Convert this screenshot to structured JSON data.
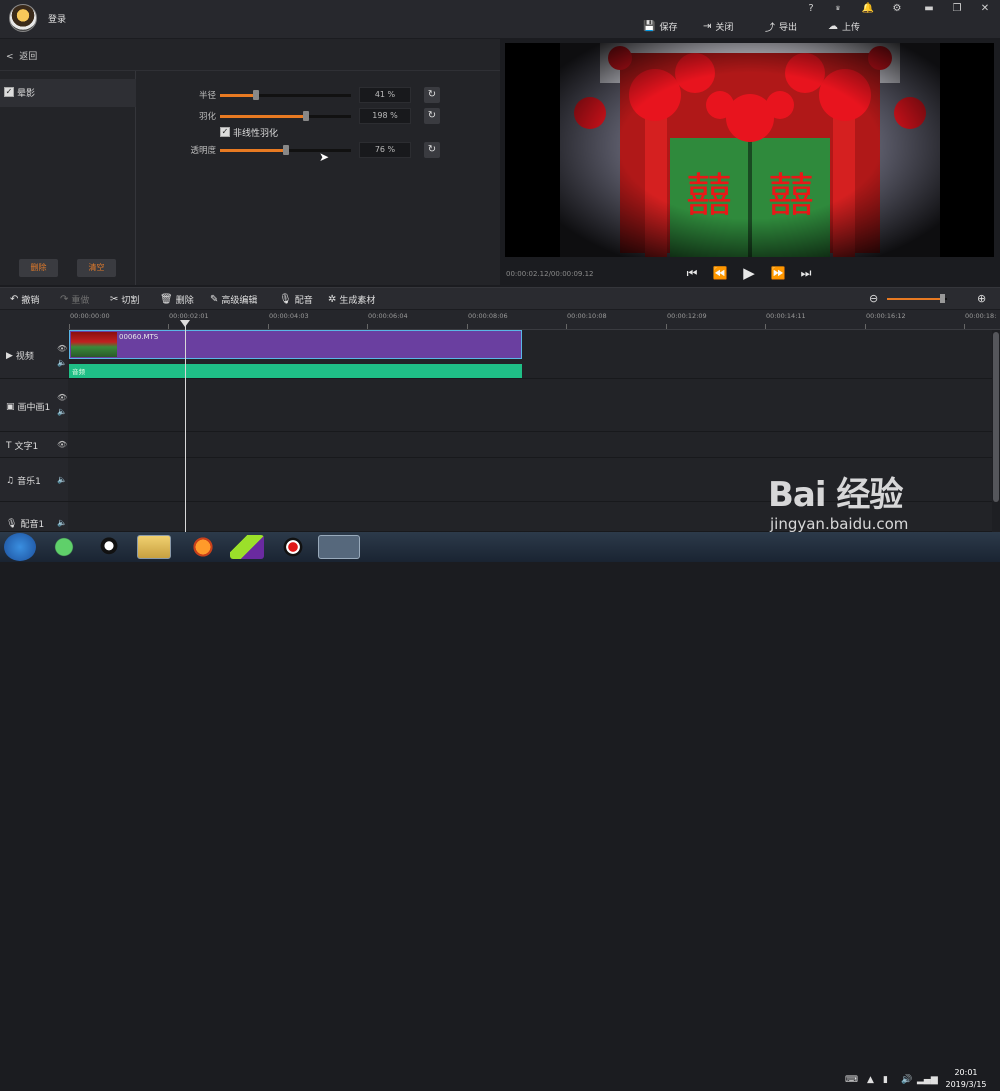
{
  "title_bar": {
    "login_label": "登录",
    "window_buttons": [
      "?",
      "VIP",
      "bell-icon",
      "gear-icon",
      "minimize",
      "restore",
      "close"
    ],
    "actions": [
      {
        "icon": "save-icon",
        "label": "保存"
      },
      {
        "icon": "exit-icon",
        "label": "关闭"
      },
      {
        "icon": "export-icon",
        "label": "导出"
      },
      {
        "icon": "upload-icon",
        "label": "上传"
      }
    ]
  },
  "effects_panel": {
    "back_label": "返回",
    "effect_name": "晕影",
    "effect_checked": true,
    "delete_label": "删除",
    "clear_label": "清空",
    "params": [
      {
        "label": "半径",
        "value": 41,
        "display": "41 %"
      },
      {
        "label": "羽化",
        "value": 198,
        "max": 300,
        "display": "198 %"
      },
      {
        "label": "透明度",
        "value": 76,
        "display": "76 %"
      }
    ],
    "nonlinear_label": "非线性羽化",
    "nonlinear_checked": true
  },
  "preview": {
    "timecode": "00:00:02.12/00:00:09.12",
    "sign_text": "囍",
    "controls": [
      "skip-start-icon",
      "prev-frame-icon",
      "play-icon",
      "next-frame-icon",
      "skip-end-icon"
    ]
  },
  "toolbar": {
    "tools": [
      {
        "icon": "undo-icon",
        "label": "撤销",
        "enabled": true
      },
      {
        "icon": "redo-icon",
        "label": "重做",
        "enabled": false
      },
      {
        "icon": "cut-icon",
        "label": "切割",
        "enabled": true
      },
      {
        "icon": "trash-icon",
        "label": "删除",
        "enabled": true
      },
      {
        "icon": "edit-icon",
        "label": "高级编辑",
        "enabled": true
      },
      {
        "icon": "mic-icon",
        "label": "配音",
        "enabled": true
      },
      {
        "icon": "film-icon",
        "label": "生成素材",
        "enabled": true
      }
    ],
    "zoom_level": 0.92
  },
  "timeline": {
    "ruler_ticks": [
      "00:00:00:00",
      "00:00:02:01",
      "00:00:04:03",
      "00:00:06:04",
      "00:00:08:06",
      "00:00:10:08",
      "00:00:12:09",
      "00:00:14:11",
      "00:00:16:12",
      "00:00:18:"
    ],
    "tracks": [
      {
        "icon": "▶",
        "label": "视频"
      },
      {
        "icon": "▣",
        "label": "画中画1"
      },
      {
        "icon": "T",
        "label": "文字1"
      },
      {
        "icon": "♫",
        "label": "音乐1"
      },
      {
        "icon": "🎙",
        "label": "配音1"
      }
    ],
    "clip_name": "00060.MTS",
    "audio_clip_label": "音频"
  },
  "taskbar": {
    "time": "20:01",
    "date": "2019/3/15",
    "apps": [
      "start",
      "360-browser",
      "qq",
      "file-explorer",
      "firefox",
      "media-app",
      "recorder",
      "video-editor"
    ]
  },
  "watermark": {
    "line1": "Bai 经验",
    "line2": "jingyan.baidu.com"
  },
  "colors": {
    "accent": "#e87a22",
    "clip": "#6a3fa0",
    "audio": "#1fbf86",
    "clip_border": "#5ab7e6"
  }
}
